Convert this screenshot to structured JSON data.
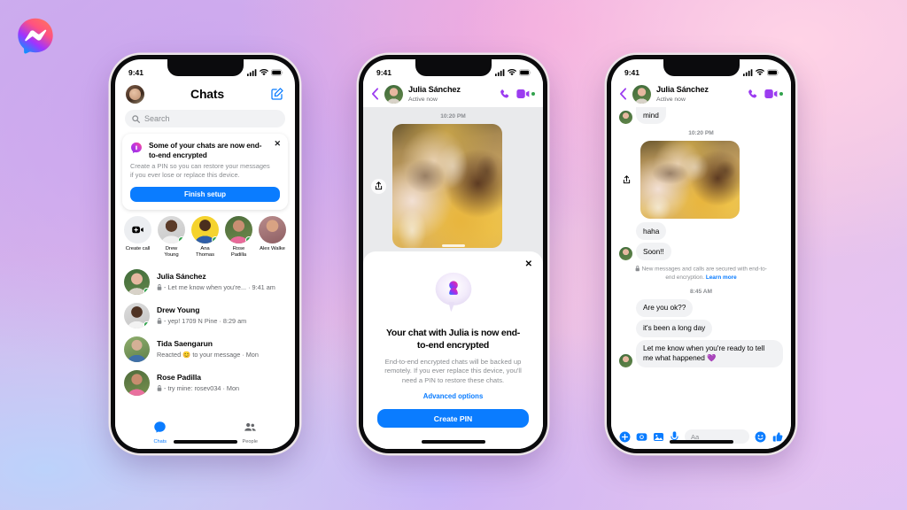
{
  "brand": {
    "logo_name": "messenger-logo",
    "accent_blue": "#0a7cff",
    "online_green": "#31a24c",
    "purple": "#9b3cf0"
  },
  "background": {
    "gradient_colors": [
      "#cdb0ee",
      "#e2b9e9",
      "#f0c2e3",
      "#bcd2fb",
      "#ffd3e6"
    ]
  },
  "phone1": {
    "status": {
      "time": "9:41",
      "signal_icon": "cellular-signal-icon",
      "wifi_icon": "wifi-icon",
      "battery_icon": "battery-icon"
    },
    "header": {
      "avatar_name": "profile-avatar",
      "title": "Chats",
      "compose_icon": "compose-icon"
    },
    "search": {
      "placeholder": "Search",
      "icon": "search-icon"
    },
    "banner": {
      "icon": "lock-bubble-icon",
      "title": "Some of your chats are now end-to-end encrypted",
      "body": "Create a PIN so you can restore your messages if you ever lose or replace this device.",
      "button": "Finish setup",
      "close_icon": "close-icon"
    },
    "stories": [
      {
        "label": "Create call",
        "type": "create",
        "icon": "video-call-icon",
        "online": false
      },
      {
        "label": "Drew Young",
        "type": "person",
        "online": true
      },
      {
        "label": "Ana Thomas",
        "type": "person",
        "online": true
      },
      {
        "label": "Rose Padilla",
        "type": "person",
        "online": true
      },
      {
        "label": "Alex Walke",
        "type": "person",
        "online": false
      }
    ],
    "chats": [
      {
        "name": "Julia Sánchez",
        "preview": "- Let me know when you're...",
        "time": "9:41 am",
        "locked": true,
        "online": true
      },
      {
        "name": "Drew Young",
        "preview": "- yep! 1709 N Pine",
        "time": "8:29 am",
        "locked": true,
        "online": true
      },
      {
        "name": "Tida Saengarun",
        "preview": "Reacted 😊 to your message",
        "time": "Mon",
        "locked": false,
        "online": false
      },
      {
        "name": "Rose Padilla",
        "preview": "- try mine: rosev034",
        "time": "Mon",
        "locked": true,
        "online": false
      }
    ],
    "tabs": [
      {
        "label": "Chats",
        "icon": "chat-bubble-icon",
        "active": true
      },
      {
        "label": "People",
        "icon": "people-icon",
        "active": false
      }
    ]
  },
  "phone2": {
    "status": {
      "time": "9:41",
      "signal_icon": "cellular-signal-icon",
      "wifi_icon": "wifi-icon",
      "battery_icon": "battery-icon"
    },
    "header": {
      "back_icon": "back-chevron-icon",
      "name": "Julia Sánchez",
      "status": "Active now",
      "call_icon": "phone-call-icon",
      "video_icon": "video-call-icon"
    },
    "timestamp": "10:20 PM",
    "share_icon": "share-icon",
    "sheet": {
      "close_icon": "close-icon",
      "illustration": "encrypted-keyhole-bubble-icon",
      "title": "Your chat with Julia is now end-to-end encrypted",
      "body": "End-to-end encrypted chats will be backed up remotely. If you ever replace this device, you'll need a PIN to restore these chats.",
      "link": "Advanced options",
      "button": "Create PIN"
    }
  },
  "phone3": {
    "status": {
      "time": "9:41",
      "signal_icon": "cellular-signal-icon",
      "wifi_icon": "wifi-icon",
      "battery_icon": "battery-icon"
    },
    "header": {
      "back_icon": "back-chevron-icon",
      "name": "Julia Sánchez",
      "status": "Active now",
      "call_icon": "phone-call-icon",
      "video_icon": "video-call-icon"
    },
    "partial_message": "mind",
    "timestamp_1": "10:20 PM",
    "share_icon": "share-icon",
    "messages_after_photo": [
      "haha",
      "Soon!!"
    ],
    "e2e_note": {
      "lock_icon": "lock-icon",
      "text": "New messages and calls are secured with end-to-end encryption.",
      "link": "Learn more"
    },
    "timestamp_2": "8:45 AM",
    "messages": [
      "Are you ok??",
      "it's been a long day",
      "Let me know when you're ready to tell me what happened 💜"
    ],
    "composer": {
      "plus_icon": "plus-icon",
      "camera_icon": "camera-icon",
      "gallery_icon": "gallery-icon",
      "mic_icon": "microphone-icon",
      "placeholder": "Aa",
      "sticker_icon": "sticker-smiley-icon",
      "like_icon": "thumbs-up-icon"
    }
  }
}
